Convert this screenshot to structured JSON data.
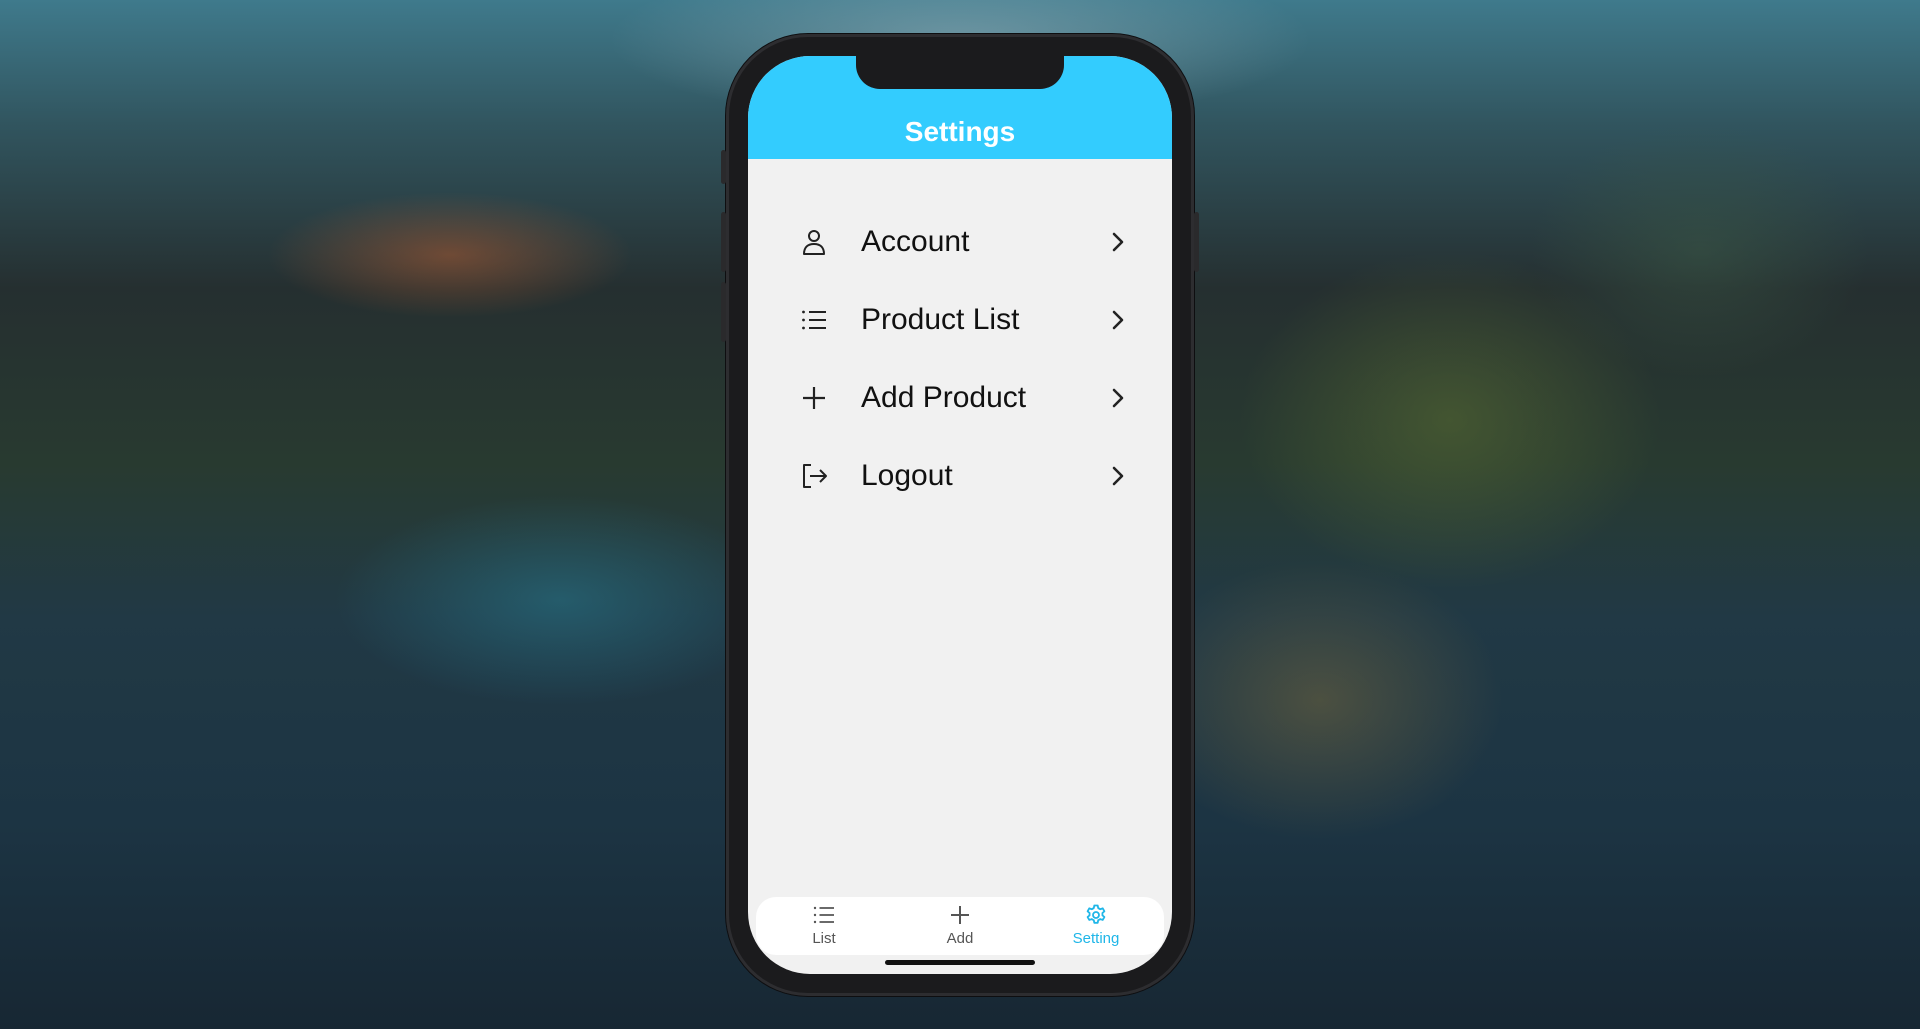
{
  "header": {
    "title": "Settings"
  },
  "menu": {
    "items": [
      {
        "label": "Account",
        "icon": "person-icon"
      },
      {
        "label": "Product List",
        "icon": "list-icon"
      },
      {
        "label": "Add Product",
        "icon": "plus-icon"
      },
      {
        "label": "Logout",
        "icon": "logout-icon"
      }
    ]
  },
  "tabbar": {
    "tabs": [
      {
        "label": "List",
        "icon": "list-icon",
        "active": false
      },
      {
        "label": "Add",
        "icon": "plus-icon",
        "active": false
      },
      {
        "label": "Setting",
        "icon": "gear-icon",
        "active": true
      }
    ]
  },
  "colors": {
    "header_bg": "#33ccfe",
    "active_tab": "#1fb6e8",
    "inactive_tab": "#555555",
    "screen_bg": "#f1f1f1"
  }
}
